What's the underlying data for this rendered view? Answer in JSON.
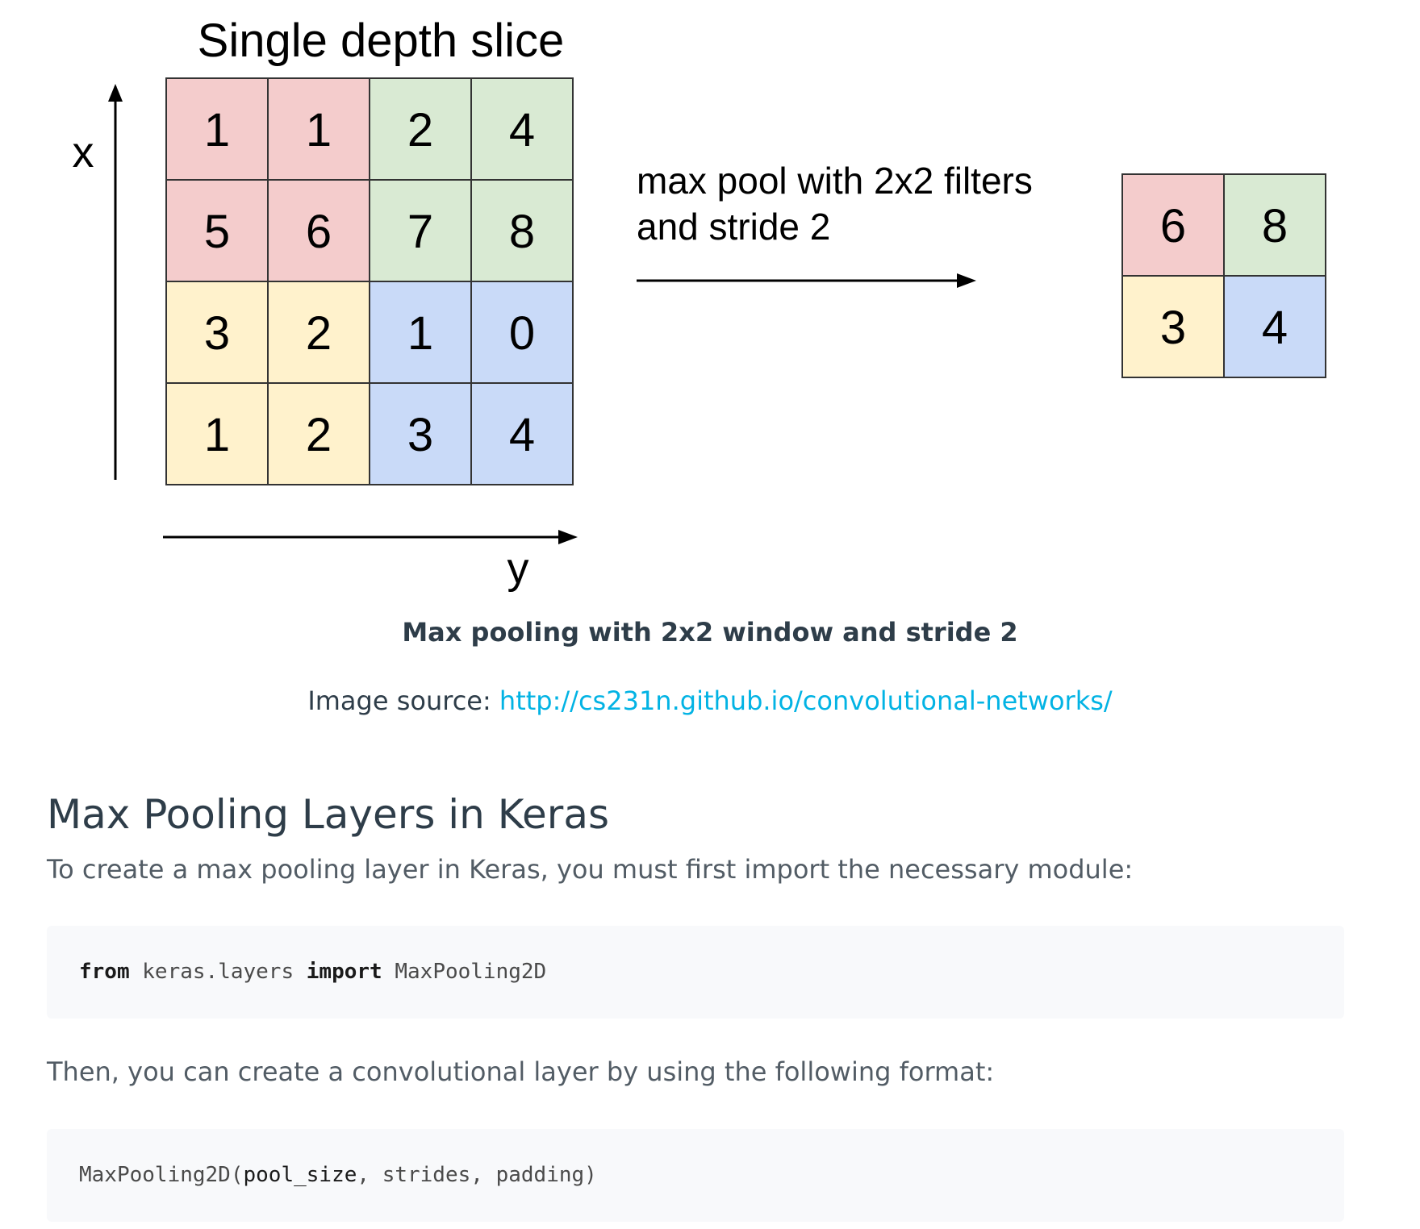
{
  "figure": {
    "title": "Single depth slice",
    "axis_x_label": "x",
    "axis_y_label": "y",
    "input_grid": [
      [
        "1",
        "1",
        "2",
        "4"
      ],
      [
        "5",
        "6",
        "7",
        "8"
      ],
      [
        "3",
        "2",
        "1",
        "0"
      ],
      [
        "1",
        "2",
        "3",
        "4"
      ]
    ],
    "operation_label_line1": "max pool with 2x2 filters",
    "operation_label_line2": "and stride 2",
    "output_grid": [
      [
        "6",
        "8"
      ],
      [
        "3",
        "4"
      ]
    ],
    "quadrant_colors": {
      "top_left": "#f4cccc",
      "top_right": "#d9ead3",
      "bottom_left": "#fff2cc",
      "bottom_right": "#c9daf8"
    }
  },
  "caption": {
    "title": "Max pooling with 2x2 window and stride 2",
    "source_prefix": "Image source: ",
    "source_link": "http://cs231n.github.io/convolutional-networks/"
  },
  "section": {
    "heading": "Max Pooling Layers in Keras",
    "intro": "To create a max pooling layer in Keras, you must first import the necessary module:",
    "code_import": {
      "kw_from": "from",
      "module": " keras.layers ",
      "kw_import": "import",
      "name": " MaxPooling2D"
    },
    "then_text": "Then, you can create a convolutional layer by using the following format:",
    "code_usage": {
      "func": "MaxPooling2D(",
      "arg1": "pool_size",
      "rest": ", strides, padding)"
    }
  }
}
